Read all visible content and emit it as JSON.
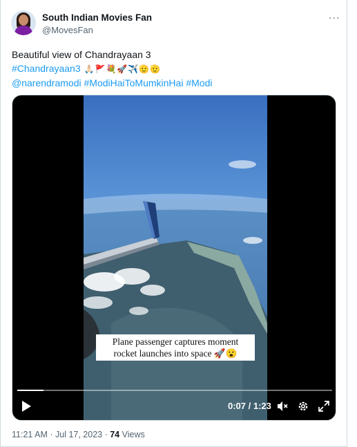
{
  "author": {
    "name": "South Indian Movies Fan",
    "handle": "@MovesFan",
    "more_label": "···"
  },
  "tweet": {
    "line1": "Beautiful view of Chandrayaan 3",
    "hashtag_chandrayaan": "#Chandrayaan3",
    "emojis": [
      "🙏🏻",
      "🚩",
      "💐",
      "🚀",
      "✈️",
      "🫡",
      "🫡"
    ],
    "mention": "@narendramodi",
    "hashtag_modihai": "#ModiHaiToMumkinHai",
    "hashtag_modi": "#Modi"
  },
  "video": {
    "caption_line1": "Plane passenger captures moment",
    "caption_line2": "rocket launches into space 🚀😮",
    "current_time": "0:07",
    "time_separator": " / ",
    "duration": "1:23",
    "progress_fraction": 0.084,
    "icons": [
      "play-icon",
      "mute-icon",
      "settings-icon",
      "fullscreen-icon"
    ]
  },
  "meta": {
    "time": "11:21 AM",
    "separator": " · ",
    "date": "Jul 17, 2023",
    "views_count": "74",
    "views_label": " Views"
  },
  "colors": {
    "link": "#1d9bf0",
    "secondary_text": "#536471",
    "primary_text": "#0f1419",
    "border": "#cfd9de"
  }
}
